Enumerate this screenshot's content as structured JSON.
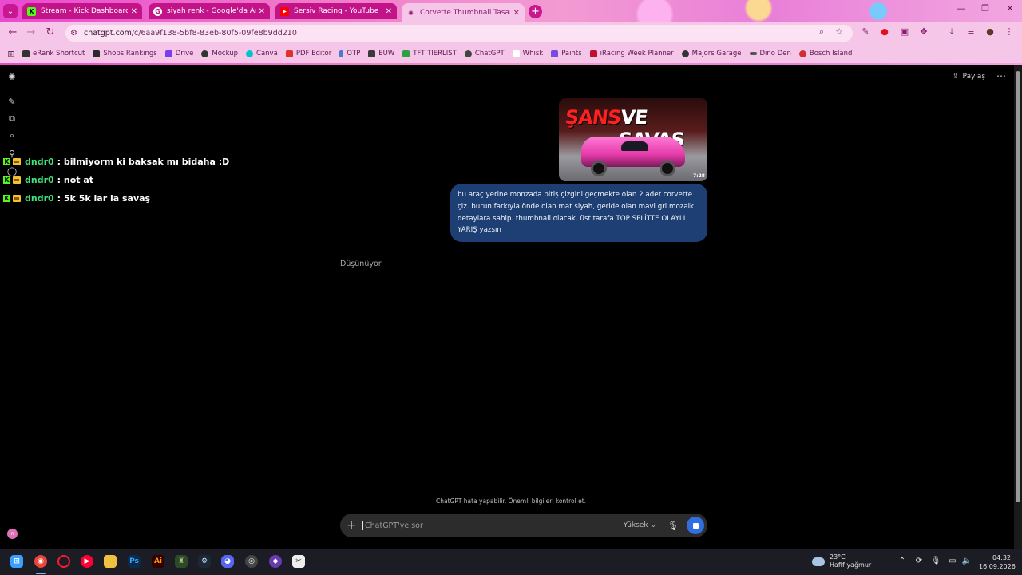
{
  "browser": {
    "tabs": [
      {
        "title": "Stream - Kick Dashboard",
        "favicon": "kick-icon",
        "favicon_color": "#53fc18"
      },
      {
        "title": "siyah renk - Google'da Ara",
        "favicon": "google-icon",
        "favicon_color": "#ffffff"
      },
      {
        "title": "Sersiv Racing - YouTube",
        "favicon": "youtube-icon",
        "favicon_color": "#ff0000"
      },
      {
        "title": "Corvette Thumbnail Tasarla",
        "favicon": "chatgpt-icon",
        "favicon_color": "#8a1e72"
      }
    ],
    "url_host": "chatgpt.com",
    "url_path": "/c/6aa9f138-5bf8-83eb-80f5-09fe8b9dd210",
    "bookmarks": [
      {
        "label": "eRank Shortcut",
        "color": "#333333"
      },
      {
        "label": "Shops Rankings",
        "color": "#2a2a2a"
      },
      {
        "label": "Drive",
        "color": "#7a3cf0"
      },
      {
        "label": "Mockup",
        "color": "#333333"
      },
      {
        "label": "Canva",
        "color": "#00c4cc"
      },
      {
        "label": "PDF Editor",
        "color": "#e03030"
      },
      {
        "label": "OTP",
        "color": "#4a7ad0"
      },
      {
        "label": "EUW",
        "color": "#3a3a3a"
      },
      {
        "label": "TFT TIERLIST",
        "color": "#2ea043"
      },
      {
        "label": "ChatGPT",
        "color": "#444444"
      },
      {
        "label": "Whisk",
        "color": "#ffffff"
      },
      {
        "label": "Paints",
        "color": "#7a4ae0"
      },
      {
        "label": "iRacing Week Planner",
        "color": "#c01030"
      },
      {
        "label": "Majors Garage",
        "color": "#333333"
      },
      {
        "label": "Dino Den",
        "color": "#555555"
      },
      {
        "label": "Bosch Island",
        "color": "#d03030"
      }
    ]
  },
  "page": {
    "share_label": "Paylaş",
    "thumbnail": {
      "word1": "ŞANS",
      "word2": "VE SAVAŞ",
      "duration": "7:28"
    },
    "user_message": "bu araç yerine monzada bitiş çizgini geçmekte olan 2 adet corvette çiz. burun farkıyla önde olan mat siyah, geride olan mavi gri mozaik detaylara sahip. thumbnail olacak. üst tarafa TOP SPLİTTE OLAYLI YARIŞ yazsın",
    "thinking_label": "Düşünüyor",
    "disclaimer": "ChatGPT hata yapabilir. Önemli bilgileri kontrol et.",
    "composer": {
      "placeholder": "ChatGPT'ye sor",
      "model_label": "Yüksek"
    },
    "avatar_initial": "n"
  },
  "stream_chat": [
    {
      "user": "dndr0",
      "message": ": bilmiyorm ki baksak mı bidaha :D"
    },
    {
      "user": "dndr0",
      "message": ": not at"
    },
    {
      "user": "dndr0",
      "message": ": 5k 5k lar la savaş"
    }
  ],
  "taskbar": {
    "weather_temp": "23°C",
    "weather_desc": "Hafif yağmur",
    "time": "04:32",
    "date": "16.09.2026"
  }
}
